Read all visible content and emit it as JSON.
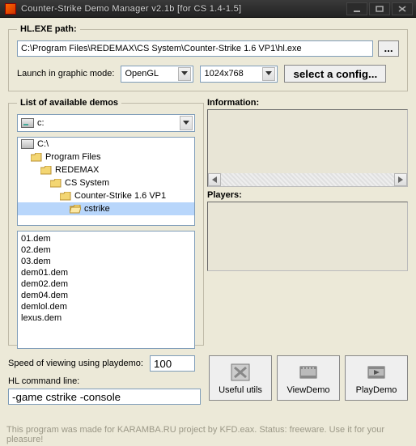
{
  "window": {
    "title": "Counter-Strike Demo Manager v2.1b [for CS 1.4-1.5]"
  },
  "hlexe": {
    "legend": "HL.EXE  path:",
    "path": "C:\\Program Files\\REDEMAX\\CS System\\Counter-Strike 1.6 VP1\\hl.exe",
    "browse": "...",
    "launch_label": "Launch in graphic mode:",
    "renderer": "OpenGL",
    "resolution": "1024x768",
    "select_config": "select a config..."
  },
  "demos": {
    "legend": "List of available demos",
    "drive": "c:",
    "tree": [
      {
        "label": "C:\\",
        "indent": 0,
        "type": "hdd"
      },
      {
        "label": "Program Files",
        "indent": 1,
        "type": "folder"
      },
      {
        "label": "REDEMAX",
        "indent": 2,
        "type": "folder"
      },
      {
        "label": "CS System",
        "indent": 3,
        "type": "folder"
      },
      {
        "label": "Counter-Strike 1.6 VP1",
        "indent": 4,
        "type": "folder"
      },
      {
        "label": "cstrike",
        "indent": 5,
        "type": "folder-open",
        "selected": true
      }
    ],
    "files": [
      "01.dem",
      "02.dem",
      "03.dem",
      "dem01.dem",
      "dem02.dem",
      "dem04.dem",
      "demlol.dem",
      "lexus.dem"
    ]
  },
  "info": {
    "legend": "Information:"
  },
  "players": {
    "legend": "Players:"
  },
  "bottom": {
    "speed_label": "Speed of viewing using playdemo:",
    "speed_value": "100",
    "cmd_label": "HL command line:",
    "cmd_value": "-game cstrike -console"
  },
  "buttons": {
    "useful": "Useful utils",
    "view": "ViewDemo",
    "play": "PlayDemo"
  },
  "status": "This program was made for KARAMBA.RU project by KFD.eax. Status: freeware. Use it for your pleasure!"
}
